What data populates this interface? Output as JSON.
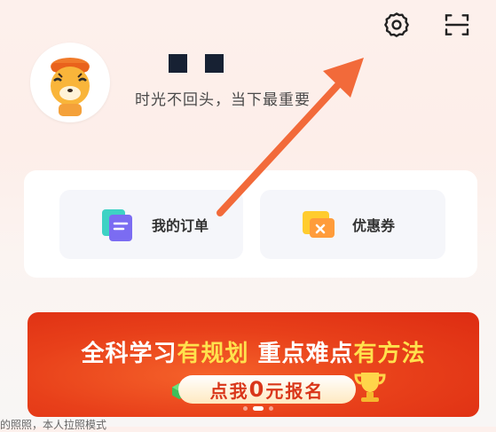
{
  "header": {
    "settings_icon": "gear-icon",
    "scan_icon": "scan-icon"
  },
  "profile": {
    "avatar_icon": "tiger-avatar-icon",
    "motto": "时光不回头，当下最重要"
  },
  "quick_entries": [
    {
      "label": "我的订单",
      "icon": "orders-icon"
    },
    {
      "label": "优惠券",
      "icon": "coupon-icon"
    }
  ],
  "banner": {
    "title_part1": "全科学习",
    "title_part2": "有规划",
    "title_part3": " 重点难点",
    "title_part4": "有方法",
    "button_prefix": "点我",
    "button_zero": "0",
    "button_suffix": "元报名"
  },
  "footer_partial": "的照照，本人拉照模式",
  "colors": {
    "accent_orange": "#f26a3a",
    "banner_red": "#e8401a",
    "highlight_yellow": "#ffe14d"
  }
}
